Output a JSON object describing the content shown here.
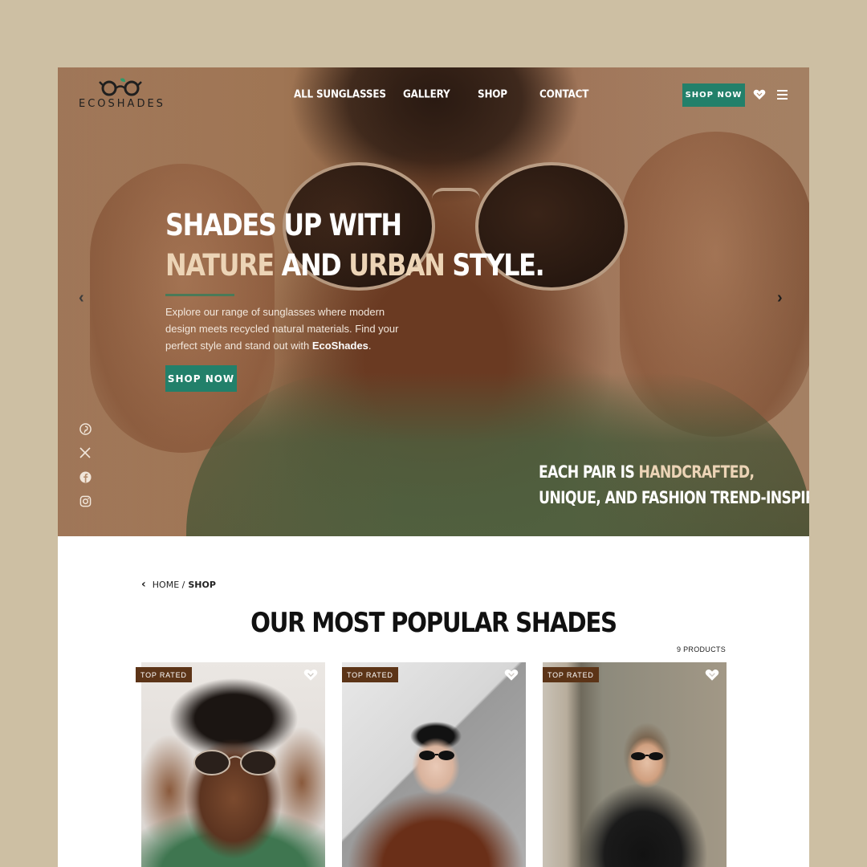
{
  "brand": {
    "name_part1": "ECO",
    "name_part2": "SHADES",
    "accent": "#22806a",
    "badge_color": "#5c3417"
  },
  "nav": {
    "items": [
      "ALL SUNGLASSES",
      "GALLERY",
      "SHOP",
      "CONTACT"
    ],
    "shop_label": "SHOP NOW",
    "favorites_icon": "heart-icon",
    "menu_icon": "hamburger-icon"
  },
  "hero": {
    "title_line1": "SHADES UP WITH",
    "title_w1": "NATURE",
    "title_w2": " AND ",
    "title_w3": "URBAN",
    "title_w4": " STYLE.",
    "desc_pre": "Explore our range of sunglasses where modern design meets recycled natural materials. Find your perfect style and stand out with ",
    "desc_brand": "EcoShades",
    "desc_post": ".",
    "cta": "SHOP NOW",
    "tag_a": "EACH PAIR IS ",
    "tag_b": "HANDCRAFTED,",
    "tag_c": "UNIQUE, AND FASHION TREND-INSPIRED.",
    "prev": "‹",
    "next": "›"
  },
  "social": [
    "pinterest-icon",
    "x-icon",
    "facebook-icon",
    "instagram-icon"
  ],
  "breadcrumb": {
    "back": "‹",
    "home": "HOME",
    "sep": "/",
    "current": "SHOP"
  },
  "section": {
    "title": "OUR MOST POPULAR SHADES",
    "count": "9 PRODUCTS"
  },
  "products": [
    {
      "badge": "TOP RATED"
    },
    {
      "badge": "TOP RATED"
    },
    {
      "badge": "TOP RATED"
    }
  ]
}
